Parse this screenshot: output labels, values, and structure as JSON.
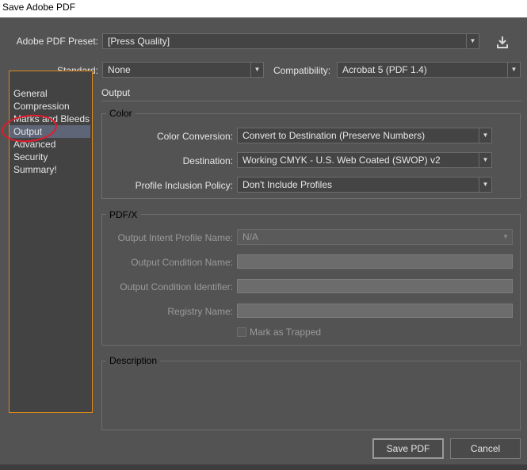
{
  "window": {
    "title": "Save Adobe PDF"
  },
  "preset": {
    "label": "Adobe PDF Preset:",
    "value": "[Press Quality]",
    "save_icon": "save-preset-icon"
  },
  "standard": {
    "label": "Standard:",
    "value": "None"
  },
  "compatibility": {
    "label": "Compatibility:",
    "value": "Acrobat 5 (PDF 1.4)"
  },
  "sidebar": {
    "items": [
      {
        "label": "General"
      },
      {
        "label": "Compression"
      },
      {
        "label": "Marks and Bleeds"
      },
      {
        "label": "Output",
        "selected": true
      },
      {
        "label": "Advanced"
      },
      {
        "label": "Security"
      },
      {
        "label": "Summary!"
      }
    ]
  },
  "main": {
    "section_title": "Output",
    "color": {
      "title": "Color",
      "conversion": {
        "label": "Color Conversion:",
        "value": "Convert to Destination (Preserve Numbers)"
      },
      "destination": {
        "label": "Destination:",
        "value": "Working CMYK - U.S. Web Coated (SWOP) v2"
      },
      "profile_policy": {
        "label": "Profile Inclusion Policy:",
        "value": "Don't Include Profiles"
      }
    },
    "pdfx": {
      "title": "PDF/X",
      "intent_profile": {
        "label": "Output Intent Profile Name:",
        "value": "N/A"
      },
      "condition_name": {
        "label": "Output Condition Name:",
        "value": ""
      },
      "condition_identifier": {
        "label": "Output Condition Identifier:",
        "value": ""
      },
      "registry_name": {
        "label": "Registry Name:",
        "value": ""
      },
      "mark_trapped": {
        "label": "Mark as Trapped",
        "checked": false
      }
    },
    "description": {
      "title": "Description"
    }
  },
  "footer": {
    "save_label": "Save PDF",
    "cancel_label": "Cancel"
  },
  "colors": {
    "dialog_bg": "#535353",
    "selection": "#5d6577",
    "sidebar_border": "#e08a18",
    "annotation_ring": "#e21b2c"
  }
}
